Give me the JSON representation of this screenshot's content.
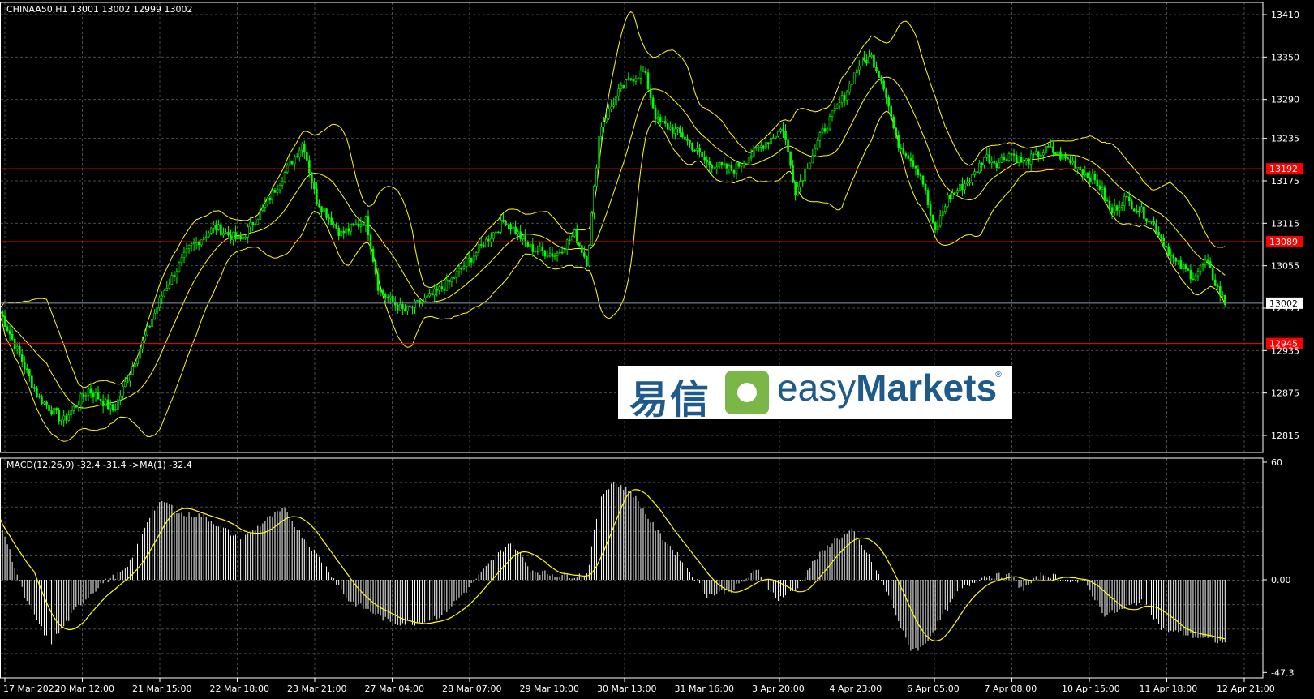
{
  "header": {
    "symbol_info": "CHINAA50,H1  13001 13002 12999 13002",
    "macd_info": "MACD(12,26,9) -32.4 -31.4   ->MA(1) -32.4"
  },
  "price_axis": {
    "ticks": [
      "13410",
      "13350",
      "13290",
      "13235",
      "13175",
      "13115",
      "13055",
      "12995",
      "12935",
      "12875",
      "12815"
    ],
    "tick_values": [
      13410,
      13350,
      13290,
      13235,
      13175,
      13115,
      13055,
      12995,
      12935,
      12875,
      12815
    ]
  },
  "macd_axis": {
    "ticks": [
      "60",
      "0.00",
      "-47.3"
    ],
    "tick_values": [
      60,
      0,
      -47.3
    ]
  },
  "levels": [
    {
      "label": "13192",
      "value": 13192,
      "color": "#ff0000"
    },
    {
      "label": "13089",
      "value": 13089,
      "color": "#ff0000"
    },
    {
      "label": "12945",
      "value": 12945,
      "color": "#ff0000"
    }
  ],
  "current_price": {
    "label": "13002",
    "value": 13002
  },
  "time_axis": [
    "17 Mar 2023",
    "20 Mar 12:00",
    "21 Mar 15:00",
    "22 Mar 18:00",
    "23 Mar 21:00",
    "27 Mar 04:00",
    "28 Mar 07:00",
    "29 Mar 10:00",
    "30 Mar 13:00",
    "31 Mar 16:00",
    "3 Apr 20:00",
    "4 Apr 23:00",
    "6 Apr 05:00",
    "7 Apr 08:00",
    "10 Apr 15:00",
    "11 Apr 18:00",
    "12 Apr 21:00"
  ],
  "logo": {
    "cn": "易信",
    "en_light": "easy",
    "en_bold": "Markets",
    "reg": "®"
  },
  "colors": {
    "candle": "#00ff00",
    "bands": "#ffff00",
    "level": "#ff0000",
    "grid": "#4a4a4a",
    "hist": "#ffffff",
    "signal": "#ffff00"
  },
  "chart_data": {
    "type": "line",
    "price_anchors": [
      [
        0,
        12990
      ],
      [
        0.015,
        12930
      ],
      [
        0.03,
        12870
      ],
      [
        0.05,
        12835
      ],
      [
        0.07,
        12880
      ],
      [
        0.09,
        12850
      ],
      [
        0.11,
        12935
      ],
      [
        0.13,
        13020
      ],
      [
        0.15,
        13080
      ],
      [
        0.17,
        13110
      ],
      [
        0.19,
        13090
      ],
      [
        0.21,
        13140
      ],
      [
        0.23,
        13200
      ],
      [
        0.24,
        13230
      ],
      [
        0.25,
        13150
      ],
      [
        0.27,
        13100
      ],
      [
        0.29,
        13120
      ],
      [
        0.3,
        13020
      ],
      [
        0.32,
        12990
      ],
      [
        0.34,
        13010
      ],
      [
        0.355,
        13030
      ],
      [
        0.37,
        13060
      ],
      [
        0.39,
        13100
      ],
      [
        0.4,
        13120
      ],
      [
        0.42,
        13080
      ],
      [
        0.44,
        13070
      ],
      [
        0.455,
        13100
      ],
      [
        0.465,
        13060
      ],
      [
        0.475,
        13250
      ],
      [
        0.49,
        13300
      ],
      [
        0.5,
        13320
      ],
      [
        0.51,
        13330
      ],
      [
        0.52,
        13260
      ],
      [
        0.54,
        13240
      ],
      [
        0.56,
        13200
      ],
      [
        0.58,
        13190
      ],
      [
        0.6,
        13220
      ],
      [
        0.62,
        13250
      ],
      [
        0.63,
        13160
      ],
      [
        0.65,
        13240
      ],
      [
        0.67,
        13300
      ],
      [
        0.68,
        13340
      ],
      [
        0.69,
        13350
      ],
      [
        0.7,
        13310
      ],
      [
        0.71,
        13230
      ],
      [
        0.72,
        13210
      ],
      [
        0.73,
        13180
      ],
      [
        0.74,
        13100
      ],
      [
        0.75,
        13150
      ],
      [
        0.77,
        13180
      ],
      [
        0.78,
        13210
      ],
      [
        0.79,
        13200
      ],
      [
        0.8,
        13215
      ],
      [
        0.81,
        13200
      ],
      [
        0.83,
        13220
      ],
      [
        0.84,
        13210
      ],
      [
        0.85,
        13200
      ],
      [
        0.87,
        13170
      ],
      [
        0.88,
        13130
      ],
      [
        0.89,
        13150
      ],
      [
        0.905,
        13130
      ],
      [
        0.915,
        13110
      ],
      [
        0.93,
        13060
      ],
      [
        0.945,
        13040
      ],
      [
        0.955,
        13060
      ],
      [
        0.965,
        13020
      ],
      [
        0.97,
        13002
      ]
    ],
    "macd_anchors": [
      [
        0,
        30
      ],
      [
        0.02,
        -10
      ],
      [
        0.04,
        -33
      ],
      [
        0.06,
        -15
      ],
      [
        0.08,
        -2
      ],
      [
        0.1,
        5
      ],
      [
        0.12,
        35
      ],
      [
        0.13,
        40
      ],
      [
        0.145,
        33
      ],
      [
        0.16,
        33
      ],
      [
        0.18,
        25
      ],
      [
        0.19,
        20
      ],
      [
        0.21,
        30
      ],
      [
        0.225,
        36
      ],
      [
        0.24,
        22
      ],
      [
        0.26,
        5
      ],
      [
        0.275,
        -10
      ],
      [
        0.29,
        -15
      ],
      [
        0.31,
        -22
      ],
      [
        0.33,
        -22
      ],
      [
        0.35,
        -18
      ],
      [
        0.37,
        -5
      ],
      [
        0.39,
        10
      ],
      [
        0.405,
        20
      ],
      [
        0.42,
        5
      ],
      [
        0.435,
        3
      ],
      [
        0.455,
        2
      ],
      [
        0.465,
        3
      ],
      [
        0.475,
        42
      ],
      [
        0.485,
        50
      ],
      [
        0.5,
        45
      ],
      [
        0.52,
        25
      ],
      [
        0.54,
        10
      ],
      [
        0.56,
        -8
      ],
      [
        0.58,
        -5
      ],
      [
        0.6,
        5
      ],
      [
        0.615,
        -10
      ],
      [
        0.63,
        -5
      ],
      [
        0.645,
        10
      ],
      [
        0.66,
        20
      ],
      [
        0.675,
        25
      ],
      [
        0.69,
        10
      ],
      [
        0.705,
        -10
      ],
      [
        0.72,
        -35
      ],
      [
        0.73,
        -35
      ],
      [
        0.745,
        -20
      ],
      [
        0.76,
        -5
      ],
      [
        0.78,
        2
      ],
      [
        0.8,
        2
      ],
      [
        0.81,
        -5
      ],
      [
        0.825,
        3
      ],
      [
        0.84,
        1
      ],
      [
        0.86,
        -2
      ],
      [
        0.875,
        -18
      ],
      [
        0.89,
        -15
      ],
      [
        0.905,
        -10
      ],
      [
        0.92,
        -25
      ],
      [
        0.94,
        -28
      ],
      [
        0.955,
        -30
      ],
      [
        0.97,
        -32.4
      ]
    ]
  }
}
